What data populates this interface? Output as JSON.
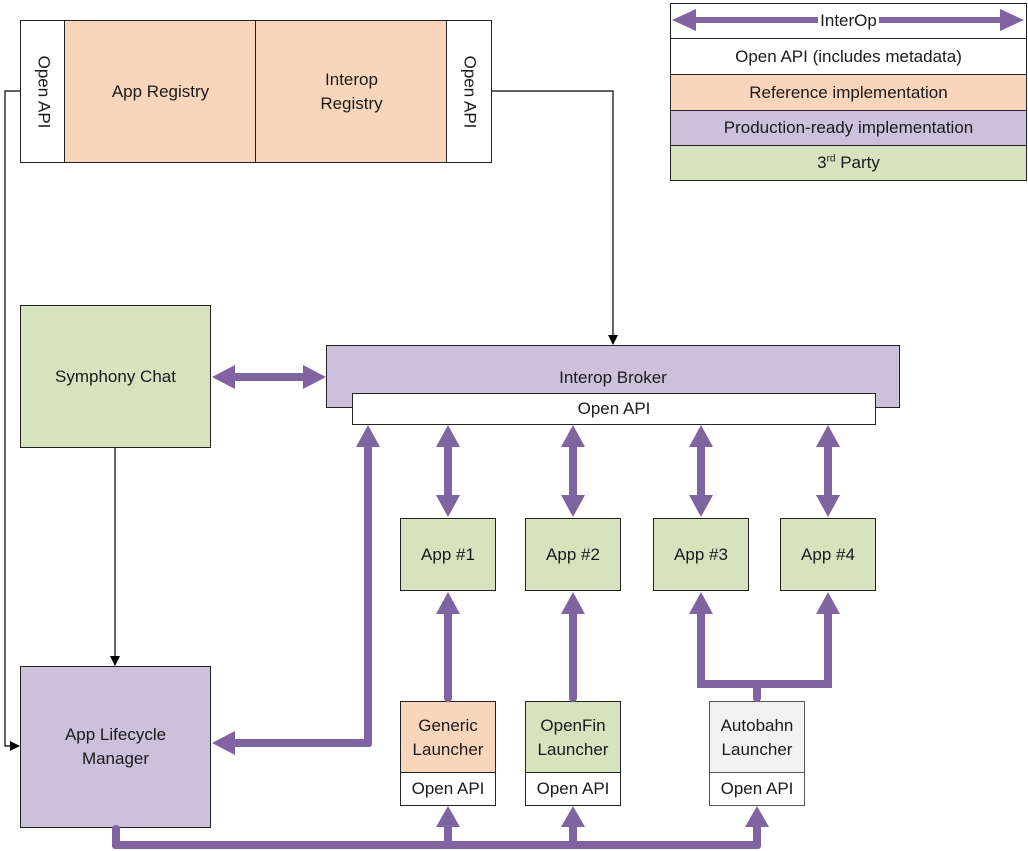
{
  "colors": {
    "interop_arrow": "#8064a2",
    "reference": "#f9d6bb",
    "production": "#ccc1da",
    "third_party": "#d7e3bf",
    "open_api": "#ffffff",
    "autobahn": "#f2f2f2",
    "connector": "#000000"
  },
  "legend": {
    "interop_label": "InterOp",
    "open_api": "Open API (includes metadata)",
    "reference": "Reference implementation",
    "production": "Production-ready implementation",
    "third_party_prefix": "3",
    "third_party_sup": "rd",
    "third_party_suffix": " Party"
  },
  "registry": {
    "left_api": "Open API",
    "app_registry": "App Registry",
    "interop_registry": "Interop\nRegistry",
    "right_api": "Open API"
  },
  "symphony_chat": "Symphony Chat",
  "broker": {
    "title": "Interop Broker",
    "api": "Open API"
  },
  "apps": [
    "App #1",
    "App #2",
    "App #3",
    "App #4"
  ],
  "launchers": [
    {
      "name": "Generic\nLauncher",
      "api": "Open API",
      "kind": "reference"
    },
    {
      "name": "OpenFin\nLauncher",
      "api": "Open API",
      "kind": "third_party"
    },
    {
      "name": "Autobahn\nLauncher",
      "api": "Open API",
      "kind": "other"
    }
  ],
  "lifecycle_manager": "App Lifecycle\nManager"
}
